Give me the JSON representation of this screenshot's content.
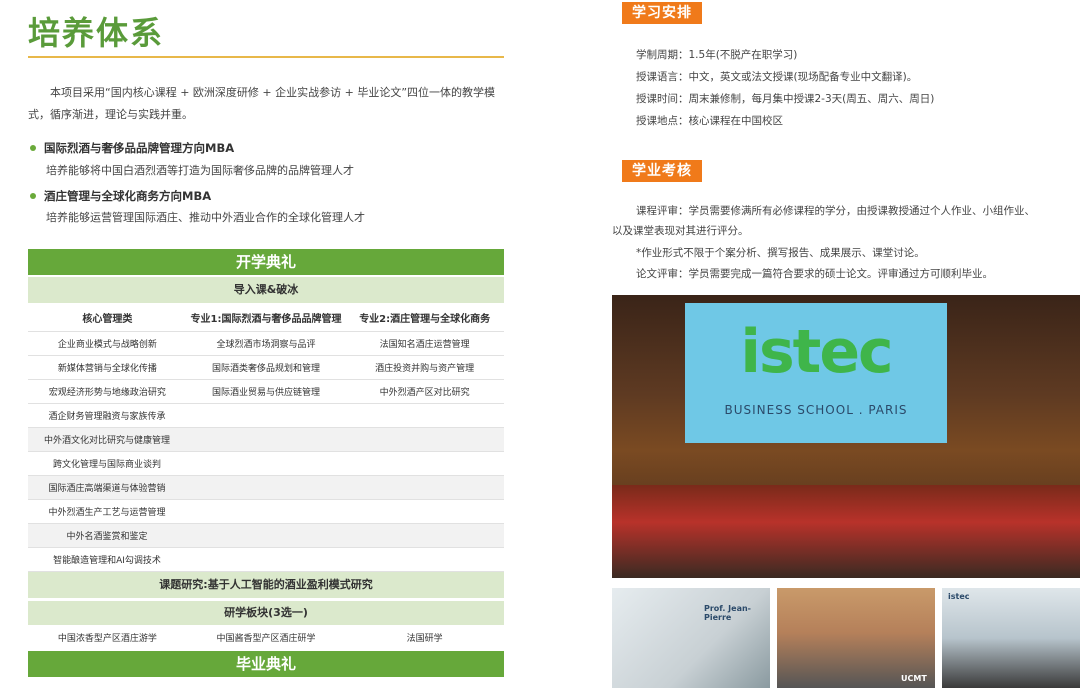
{
  "left": {
    "title": "培养体系",
    "intro": "本项目采用“国内核心课程 + 欧洲深度研修 + 企业实战参访 + 毕业论文”四位一体的教学模式，循序渐进，理论与实践并重。",
    "bullets": [
      {
        "title": "国际烈酒与奢侈品品牌管理方向MBA",
        "desc": "培养能够将中国白酒烈酒等打造为国际奢侈品牌的品牌管理人才"
      },
      {
        "title": "酒庄管理与全球化商务方向MBA",
        "desc": "培养能够运营管理国际酒庄、推动中外酒业合作的全球化管理人才"
      }
    ]
  },
  "table": {
    "opening": "开学典礼",
    "intro_course": "导入课&破冰",
    "headers": [
      "核心管理类",
      "专业1:国际烈酒与奢侈品品牌管理",
      "专业2:酒庄管理与全球化商务"
    ],
    "rows": [
      [
        "企业商业模式与战略创新",
        "全球烈酒市场洞察与品评",
        "法国知名酒庄运营管理"
      ],
      [
        "新媒体营销与全球化传播",
        "国际酒类奢侈品规划和管理",
        "酒庄投资并购与资产管理"
      ],
      [
        "宏观经济形势与地缘政治研究",
        "国际酒业贸易与供应链管理",
        "中外烈酒产区对比研究"
      ],
      [
        "酒企财务管理融资与家族传承",
        "",
        ""
      ],
      [
        "中外酒文化对比研究与健康管理",
        "",
        ""
      ],
      [
        "跨文化管理与国际商业谈判",
        "",
        ""
      ],
      [
        "国际酒庄高端渠道与体验营销",
        "",
        ""
      ],
      [
        "中外烈酒生产工艺与运营管理",
        "",
        ""
      ],
      [
        "中外名酒鉴赏和鉴定",
        "",
        ""
      ],
      [
        "智能酿造管理和AI勾调技术",
        "",
        ""
      ]
    ],
    "research": "课题研究:基于人工智能的酒业盈利模式研究",
    "study": "研学板块(3选一)",
    "study_options": [
      "中国浓香型产区酒庄游学",
      "中国酱香型产区酒庄研学",
      "法国研学"
    ],
    "graduation": "毕业典礼"
  },
  "right": {
    "arrangement_title": "学习安排",
    "arrangement": [
      "学制周期：1.5年(不脱产在职学习)",
      "授课语言：中文，英文或法文授课(现场配备专业中文翻译)。",
      "授课时间：周末兼修制，每月集中授课2-3天(周五、周六、周日)",
      "授课地点：核心课程在中国校区"
    ],
    "assessment_title": "学业考核",
    "assessment_line1": "课程评审：学员需要修满所有必修课程的学分，由授课教授通过个人作业、小组作业、",
    "assessment_line2": "以及课堂表现对其进行评分。",
    "assessment_note": "*作业形式不限于个案分析、撰写报告、成果展示、课堂讨论。",
    "assessment_thesis": "论文评审：学员需要完成一篇符合要求的硕士论文。评审通过方可顺利毕业。",
    "photo_logo": "istec",
    "photo_sub": "BUSINESS SCHOOL . PARIS",
    "thumb1_text": "Prof. Jean-Pierre",
    "thumb2_text": "UCMT",
    "thumb3_text": "istec"
  }
}
